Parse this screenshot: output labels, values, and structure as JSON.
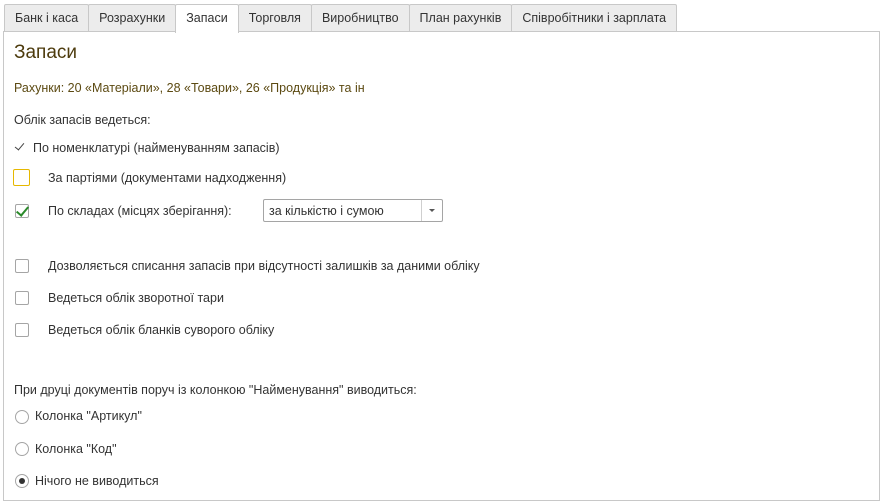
{
  "tabs": [
    {
      "label": "Банк і каса"
    },
    {
      "label": "Розрахунки"
    },
    {
      "label": "Запаси"
    },
    {
      "label": "Торговля"
    },
    {
      "label": "Виробництво"
    },
    {
      "label": "План рахунків"
    },
    {
      "label": "Співробітники і зарплата"
    }
  ],
  "active_tab": "Запаси",
  "page": {
    "title": "Запаси",
    "accounts_note": "Рахунки: 20 «Матеріали», 28 «Товари», 26 «Продукція» та ін"
  },
  "accounting": {
    "heading": "Облік запасів ведеться:",
    "by_nomenclature": "По номенклатурі (найменуванням запасів)",
    "by_batches": {
      "label": "За партіями (документами надходження)",
      "checked": false
    },
    "by_warehouses": {
      "label": "По складах (місцях зберігання):",
      "checked": true
    },
    "warehouses_mode": "за кількістю і сумою"
  },
  "options": {
    "allow_writeoff": {
      "label": "Дозволяється списання запасів при відсутності залишків за даними обліку",
      "checked": false
    },
    "returnable_packaging": {
      "label": "Ведеться облік зворотної тари",
      "checked": false
    },
    "strict_forms": {
      "label": "Ведеться облік бланків суворого обліку",
      "checked": false
    }
  },
  "printing": {
    "heading": "При друці документів поруч із колонкою \"Найменування\" виводиться:",
    "options": [
      {
        "label": "Колонка \"Артикул\"",
        "selected": false
      },
      {
        "label": "Колонка \"Код\"",
        "selected": false
      },
      {
        "label": "Нічого не виводиться",
        "selected": true
      }
    ]
  }
}
